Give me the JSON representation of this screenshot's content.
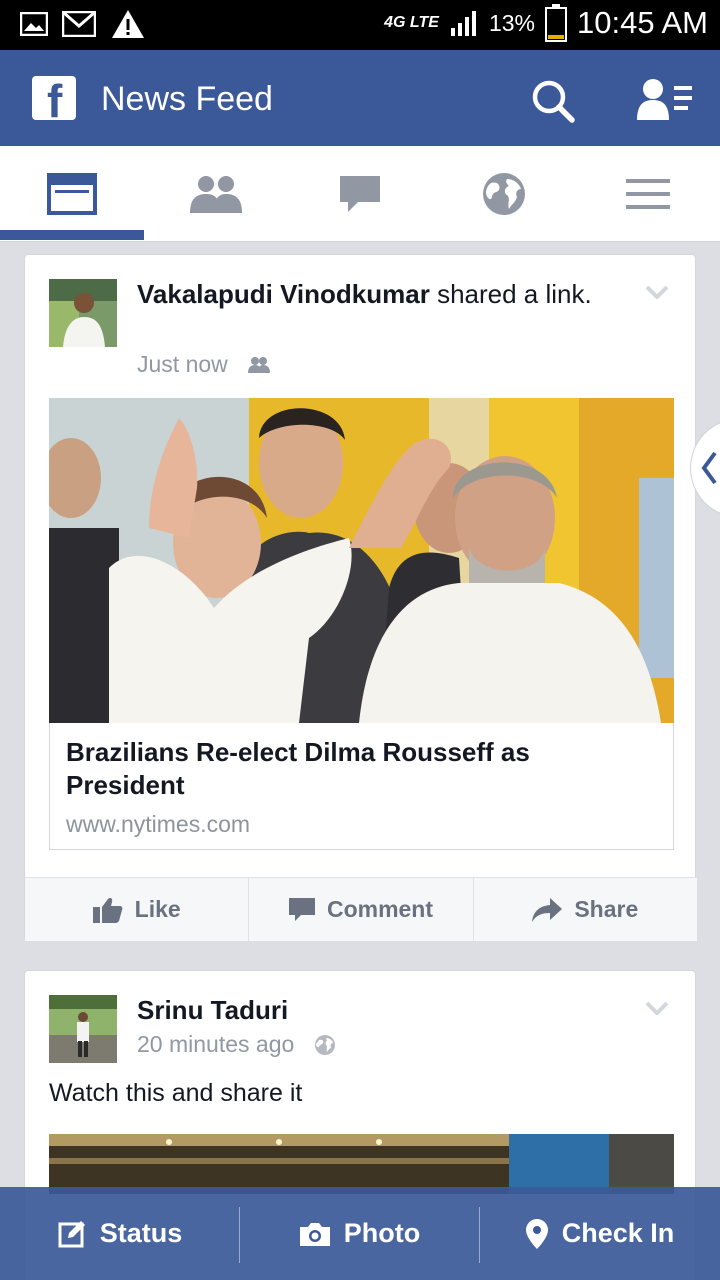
{
  "status_bar": {
    "network": "4G LTE",
    "battery_percent": "13%",
    "time": "10:45 AM",
    "left_icons": [
      "image-icon",
      "gmail-icon",
      "warning-icon"
    ]
  },
  "app_bar": {
    "logo": "f",
    "title": "News Feed",
    "icons": [
      "search-icon",
      "friend-requests-icon"
    ]
  },
  "tabs": [
    {
      "name": "news-feed",
      "icon": "news-feed-icon",
      "active": true
    },
    {
      "name": "friends",
      "icon": "friends-icon",
      "active": false
    },
    {
      "name": "messages",
      "icon": "chat-icon",
      "active": false
    },
    {
      "name": "notifications",
      "icon": "globe-icon",
      "active": false
    },
    {
      "name": "more",
      "icon": "menu-icon",
      "active": false
    }
  ],
  "posts": [
    {
      "author": "Vakalapudi Vinodkumar",
      "action": " shared a link.",
      "time": "Just now",
      "audience_icon": "friends-icon",
      "link": {
        "title": "Brazilians Re-elect Dilma Rousseff as President",
        "url": "www.nytimes.com"
      },
      "actions": {
        "like": "Like",
        "comment": "Comment",
        "share": "Share"
      }
    },
    {
      "author": "Srinu Taduri",
      "time": "20 minutes ago",
      "audience_icon": "globe-icon",
      "text": "Watch this and share it"
    }
  ],
  "bottom_bar": {
    "status": "Status",
    "photo": "Photo",
    "checkin": "Check In"
  },
  "colors": {
    "brand": "#3b5998",
    "background": "#dcdee3"
  }
}
